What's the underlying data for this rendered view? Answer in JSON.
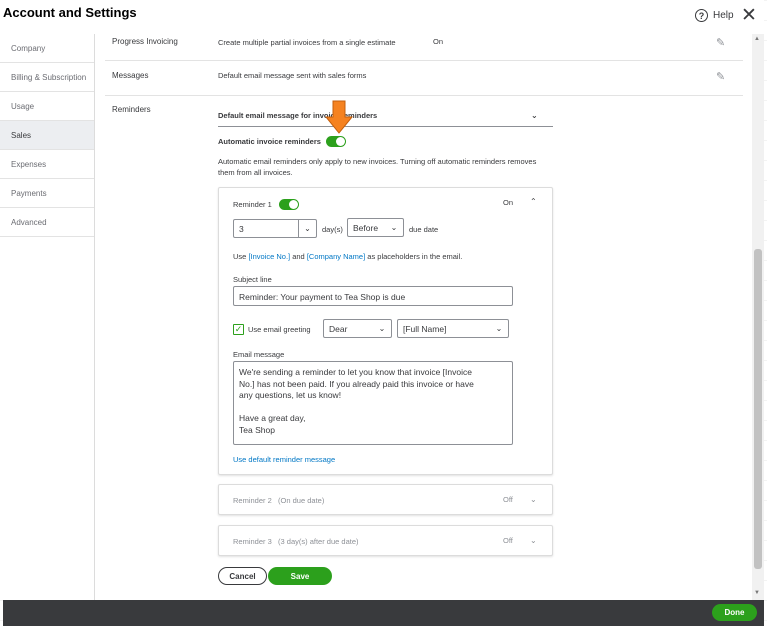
{
  "window": {
    "title": "Account and Settings",
    "help_label": "Help",
    "help_icon_glyph": "?",
    "close_glyph": "✕"
  },
  "sidebar": {
    "items": [
      {
        "label": "Company",
        "active": false
      },
      {
        "label": "Billing & Subscription",
        "active": false
      },
      {
        "label": "Usage",
        "active": false
      },
      {
        "label": "Sales",
        "active": true
      },
      {
        "label": "Expenses",
        "active": false
      },
      {
        "label": "Payments",
        "active": false
      },
      {
        "label": "Advanced",
        "active": false
      }
    ]
  },
  "rows": {
    "progress_invoicing": {
      "label": "Progress Invoicing",
      "description": "Create multiple partial invoices from a single estimate",
      "value": "On"
    },
    "messages": {
      "label": "Messages",
      "description": "Default email message sent with sales forms"
    },
    "reminders": {
      "label": "Reminders"
    }
  },
  "reminders": {
    "section_header": "Default email message for invoice reminders",
    "automatic_label": "Automatic invoice reminders",
    "automatic_enabled": true,
    "note": "Automatic email reminders only apply to new invoices. Turning off automatic reminders removes them from all invoices.",
    "reminder1": {
      "title": "Reminder 1",
      "enabled": true,
      "state": "On",
      "days_value": "3",
      "days_suffix": "day(s)",
      "timing_value": "Before",
      "timing_suffix": "due date",
      "placeholder_prefix": "Use",
      "placeholder_invoice": "[Invoice No.]",
      "placeholder_and": "and",
      "placeholder_company": "[Company Name]",
      "placeholder_suffix": "as placeholders in the email.",
      "subject_label": "Subject line",
      "subject_value": "Reminder: Your payment to Tea Shop is due",
      "use_greeting_label": "Use email greeting",
      "use_greeting_checked": true,
      "greeting_value": "Dear",
      "name_value": "[Full Name]",
      "message_label": "Email message",
      "message_value": "We're sending a reminder to let you know that invoice [Invoice\nNo.] has not been paid. If you already paid this invoice or have\nany questions, let us know!\n\nHave a great day,\nTea Shop",
      "default_link": "Use default reminder message"
    },
    "reminder2": {
      "title": "Reminder 2",
      "subtitle": "(On due date)",
      "state": "Off"
    },
    "reminder3": {
      "title": "Reminder 3",
      "subtitle": "(3 day(s) after due date)",
      "state": "Off"
    }
  },
  "actions": {
    "cancel_label": "Cancel",
    "save_label": "Save",
    "done_label": "Done"
  },
  "icons": {
    "edit": "pencil-icon",
    "expand": "chevron-down-icon",
    "collapse": "chevron-up-icon",
    "annotation": "orange-arrow-icon"
  },
  "colors": {
    "accent_green": "#2ca01c",
    "link_blue": "#0077c5",
    "annotation_orange": "#f58220",
    "footer_bg": "#393a3d"
  }
}
